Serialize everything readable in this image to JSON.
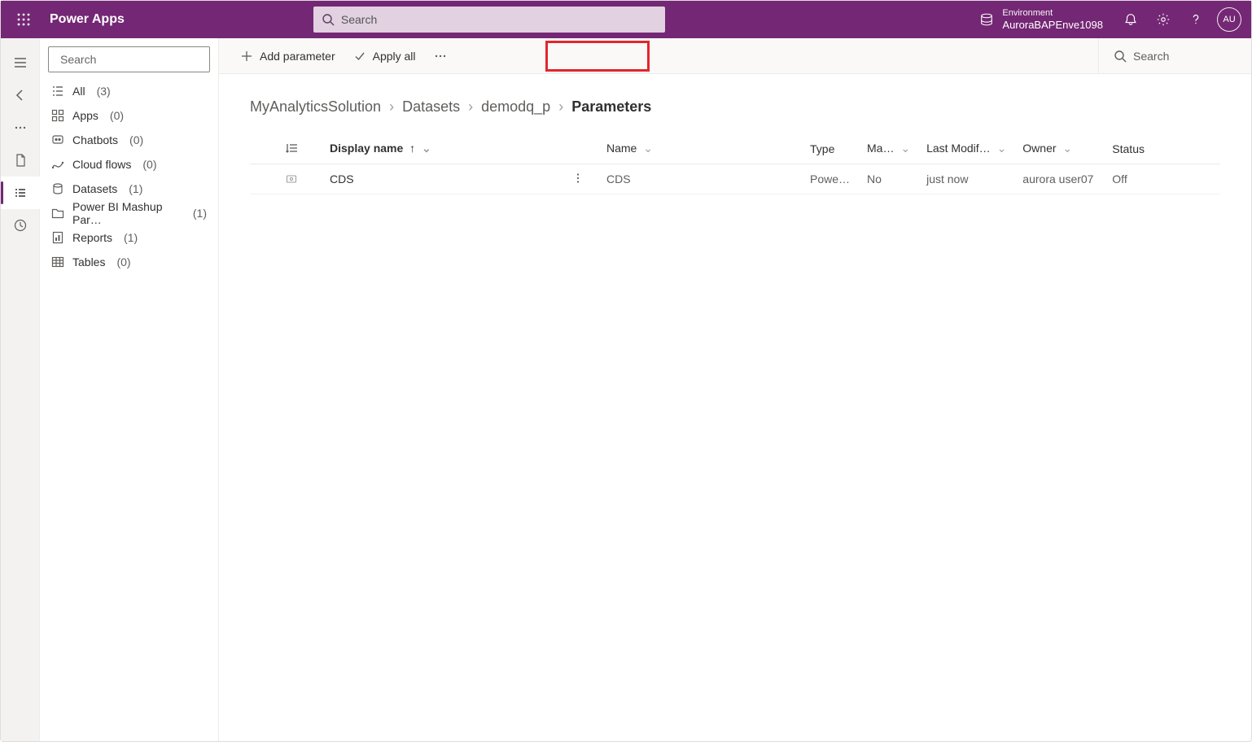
{
  "brand": "Power Apps",
  "globalSearchPlaceholder": "Search",
  "env": {
    "label": "Environment",
    "name": "AuroraBAPEnve1098"
  },
  "avatarInitials": "AU",
  "panelSearchPlaceholder": "Search",
  "nav": {
    "all": {
      "label": "All",
      "count": "(3)"
    },
    "apps": {
      "label": "Apps",
      "count": "(0)"
    },
    "chatbots": {
      "label": "Chatbots",
      "count": "(0)"
    },
    "cloudflows": {
      "label": "Cloud flows",
      "count": "(0)"
    },
    "datasets": {
      "label": "Datasets",
      "count": "(1)"
    },
    "pbi": {
      "label": "Power BI Mashup Par…",
      "count": "(1)"
    },
    "reports": {
      "label": "Reports",
      "count": "(1)"
    },
    "tables": {
      "label": "Tables",
      "count": "(0)"
    }
  },
  "cmd": {
    "addParameter": "Add parameter",
    "applyAll": "Apply all",
    "search": "Search"
  },
  "breadcrumb": {
    "root": "MyAnalyticsSolution",
    "l2": "Datasets",
    "l3": "demodq_p",
    "l4": "Parameters"
  },
  "columns": {
    "displayName": "Display name",
    "name": "Name",
    "type": "Type",
    "managed": "Ma…",
    "lastModified": "Last Modif…",
    "owner": "Owner",
    "status": "Status"
  },
  "rows": [
    {
      "displayName": "CDS",
      "name": "CDS",
      "type": "Power …",
      "managed": "No",
      "lastModified": "just now",
      "owner": "aurora user07",
      "status": "Off"
    }
  ]
}
